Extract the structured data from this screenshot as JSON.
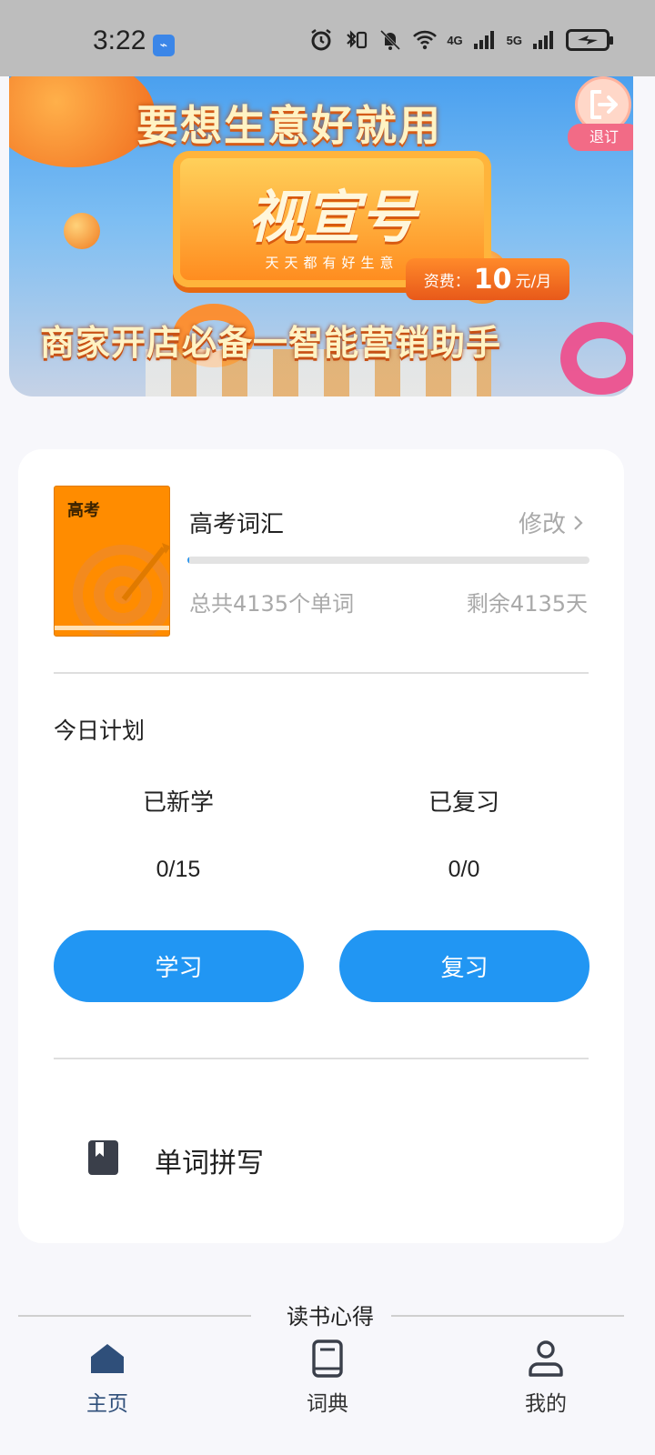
{
  "status_bar": {
    "time": "3:22",
    "network_labels": [
      "4G",
      "5G"
    ]
  },
  "banner": {
    "headline": "要想生意好就用",
    "brand": "视宣号",
    "brand_subtitle": "天天都有好生意",
    "price_prefix": "资费：",
    "price_value": "10",
    "price_unit": "元/月",
    "tagline": "商家开店必备一智能营销助手",
    "unsubscribe_label": "退订"
  },
  "wordbook": {
    "cover_label": "高考",
    "title": "高考词汇",
    "modify_label": "修改",
    "progress_fraction": 0.005,
    "total_words": "总共4135个单词",
    "remaining_days": "剩余4135天"
  },
  "plan": {
    "title": "今日计划",
    "learned_label": "已新学",
    "learned_value": "0/15",
    "reviewed_label": "已复习",
    "reviewed_value": "0/0",
    "learn_button": "学习",
    "review_button": "复习"
  },
  "spelling": {
    "label": "单词拼写",
    "icon": "bookmark-book-icon"
  },
  "section": {
    "heading": "读书心得"
  },
  "bottom_nav": {
    "items": [
      {
        "label": "主页",
        "icon": "home-icon",
        "active": true
      },
      {
        "label": "词典",
        "icon": "dictionary-icon",
        "active": false
      },
      {
        "label": "我的",
        "icon": "profile-icon",
        "active": false
      }
    ]
  },
  "colors": {
    "primary": "#2196f3",
    "active_nav": "#2f4f7a",
    "muted_text": "#a9a9a9",
    "cover": "#ff8c00"
  }
}
